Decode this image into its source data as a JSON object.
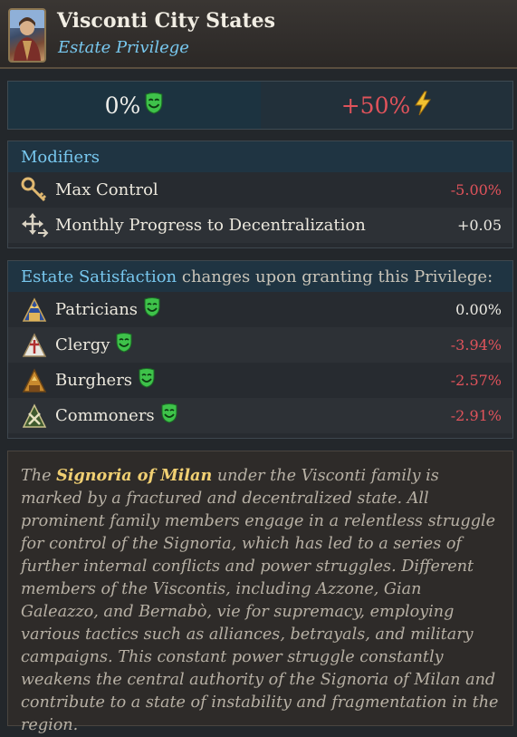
{
  "header": {
    "title": "Visconti City States",
    "subtitle": "Estate Privilege",
    "portrait_icon": "portrait-icon"
  },
  "stats": {
    "satisfaction_value": "0%",
    "satisfaction_icon": "happy-mask-icon",
    "power_value": "+50%",
    "power_icon": "lightning-icon"
  },
  "modifiers": {
    "heading": "Modifiers",
    "rows": [
      {
        "icon": "key-icon",
        "label": "Max Control",
        "value": "-5.00%"
      },
      {
        "icon": "decentralization-arrows-icon",
        "label": "Monthly Progress to Decentralization",
        "value": "+0.05"
      }
    ]
  },
  "satisfaction": {
    "heading": "Estate Satisfaction",
    "heading_rest": " changes upon granting this Privilege:",
    "rows": [
      {
        "icon": "patricians-icon",
        "label": "Patricians",
        "value": "0.00%"
      },
      {
        "icon": "clergy-icon",
        "label": "Clergy",
        "value": "-3.94%"
      },
      {
        "icon": "burghers-icon",
        "label": "Burghers",
        "value": "-2.57%"
      },
      {
        "icon": "commoners-icon",
        "label": "Commoners",
        "value": "-2.91%"
      }
    ]
  },
  "description": {
    "intro": "The ",
    "highlight": "Signoria of Milan",
    "text": " under the Visconti family is marked by a fractured and decentralized state. All prominent family members engage in a relentless struggle for control of the Signoria, which has led to a series of further internal conflicts and power struggles. Different members of the Viscontis, including Azzone, Gian Galeazzo, and Bernabò, vie for supremacy, employing various tactics such as alliances, betrayals, and military campaigns. This constant power struggle constantly weakens the central authority of the Signoria of Milan and contribute to a state of instability and fragmentation in the region."
  },
  "colors": {
    "accent_blue": "#78c8ef",
    "negative": "#e0535b",
    "highlight": "#f0cf72",
    "mask_green": "#3ec24a"
  }
}
